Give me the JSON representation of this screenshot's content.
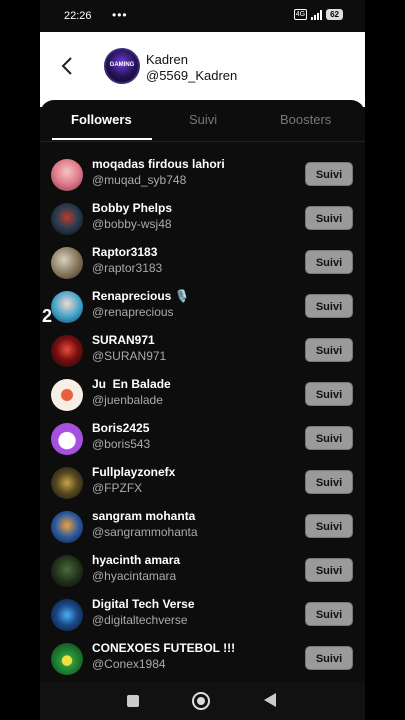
{
  "status_bar": {
    "time": "22:26",
    "dots": "•••",
    "network": "4G",
    "battery": "62"
  },
  "header": {
    "name": "Kadren",
    "handle": "@5569_Kadren",
    "avatar_text": "GAMING"
  },
  "tabs": [
    {
      "label": "Followers",
      "active": true
    },
    {
      "label": "Suivi",
      "active": false
    },
    {
      "label": "Boosters",
      "active": false
    }
  ],
  "followers": [
    {
      "name": "moqadas firdous lahori",
      "handle": "@muqad_syb748",
      "button": "Suivi"
    },
    {
      "name": "Bobby Phelps",
      "handle": "@bobby-wsj48",
      "button": "Suivi"
    },
    {
      "name": "Raptor3183",
      "handle": "@raptor3183",
      "button": "Suivi"
    },
    {
      "name": "Renaprecious",
      "handle": "@renaprecious",
      "button": "Suivi"
    },
    {
      "name": "SURAN971",
      "handle": "@SURAN971",
      "button": "Suivi"
    },
    {
      "name": "Ju  En Balade",
      "handle": "@juenbalade",
      "button": "Suivi"
    },
    {
      "name": "Boris2425",
      "handle": "@boris543",
      "button": "Suivi"
    },
    {
      "name": "Fullplayzonefx",
      "handle": "@FPZFX",
      "button": "Suivi"
    },
    {
      "name": "sangram mohanta",
      "handle": "@sangrammohanta",
      "button": "Suivi"
    },
    {
      "name": "hyacinth amara",
      "handle": "@hyacintamara",
      "button": "Suivi"
    },
    {
      "name": "Digital Tech Verse",
      "handle": "@digitaltechverse",
      "button": "Suivi"
    },
    {
      "name": "CONEXOES FUTEBOL !!!",
      "handle": "@Conex1984",
      "button": "Suivi"
    }
  ],
  "overlay_number": "2",
  "colors": {
    "panel_bg": "#0d0d0d",
    "header_bg": "#ffffff",
    "button_bg": "#9a9a9a",
    "muted_text": "#aaaaaa"
  }
}
